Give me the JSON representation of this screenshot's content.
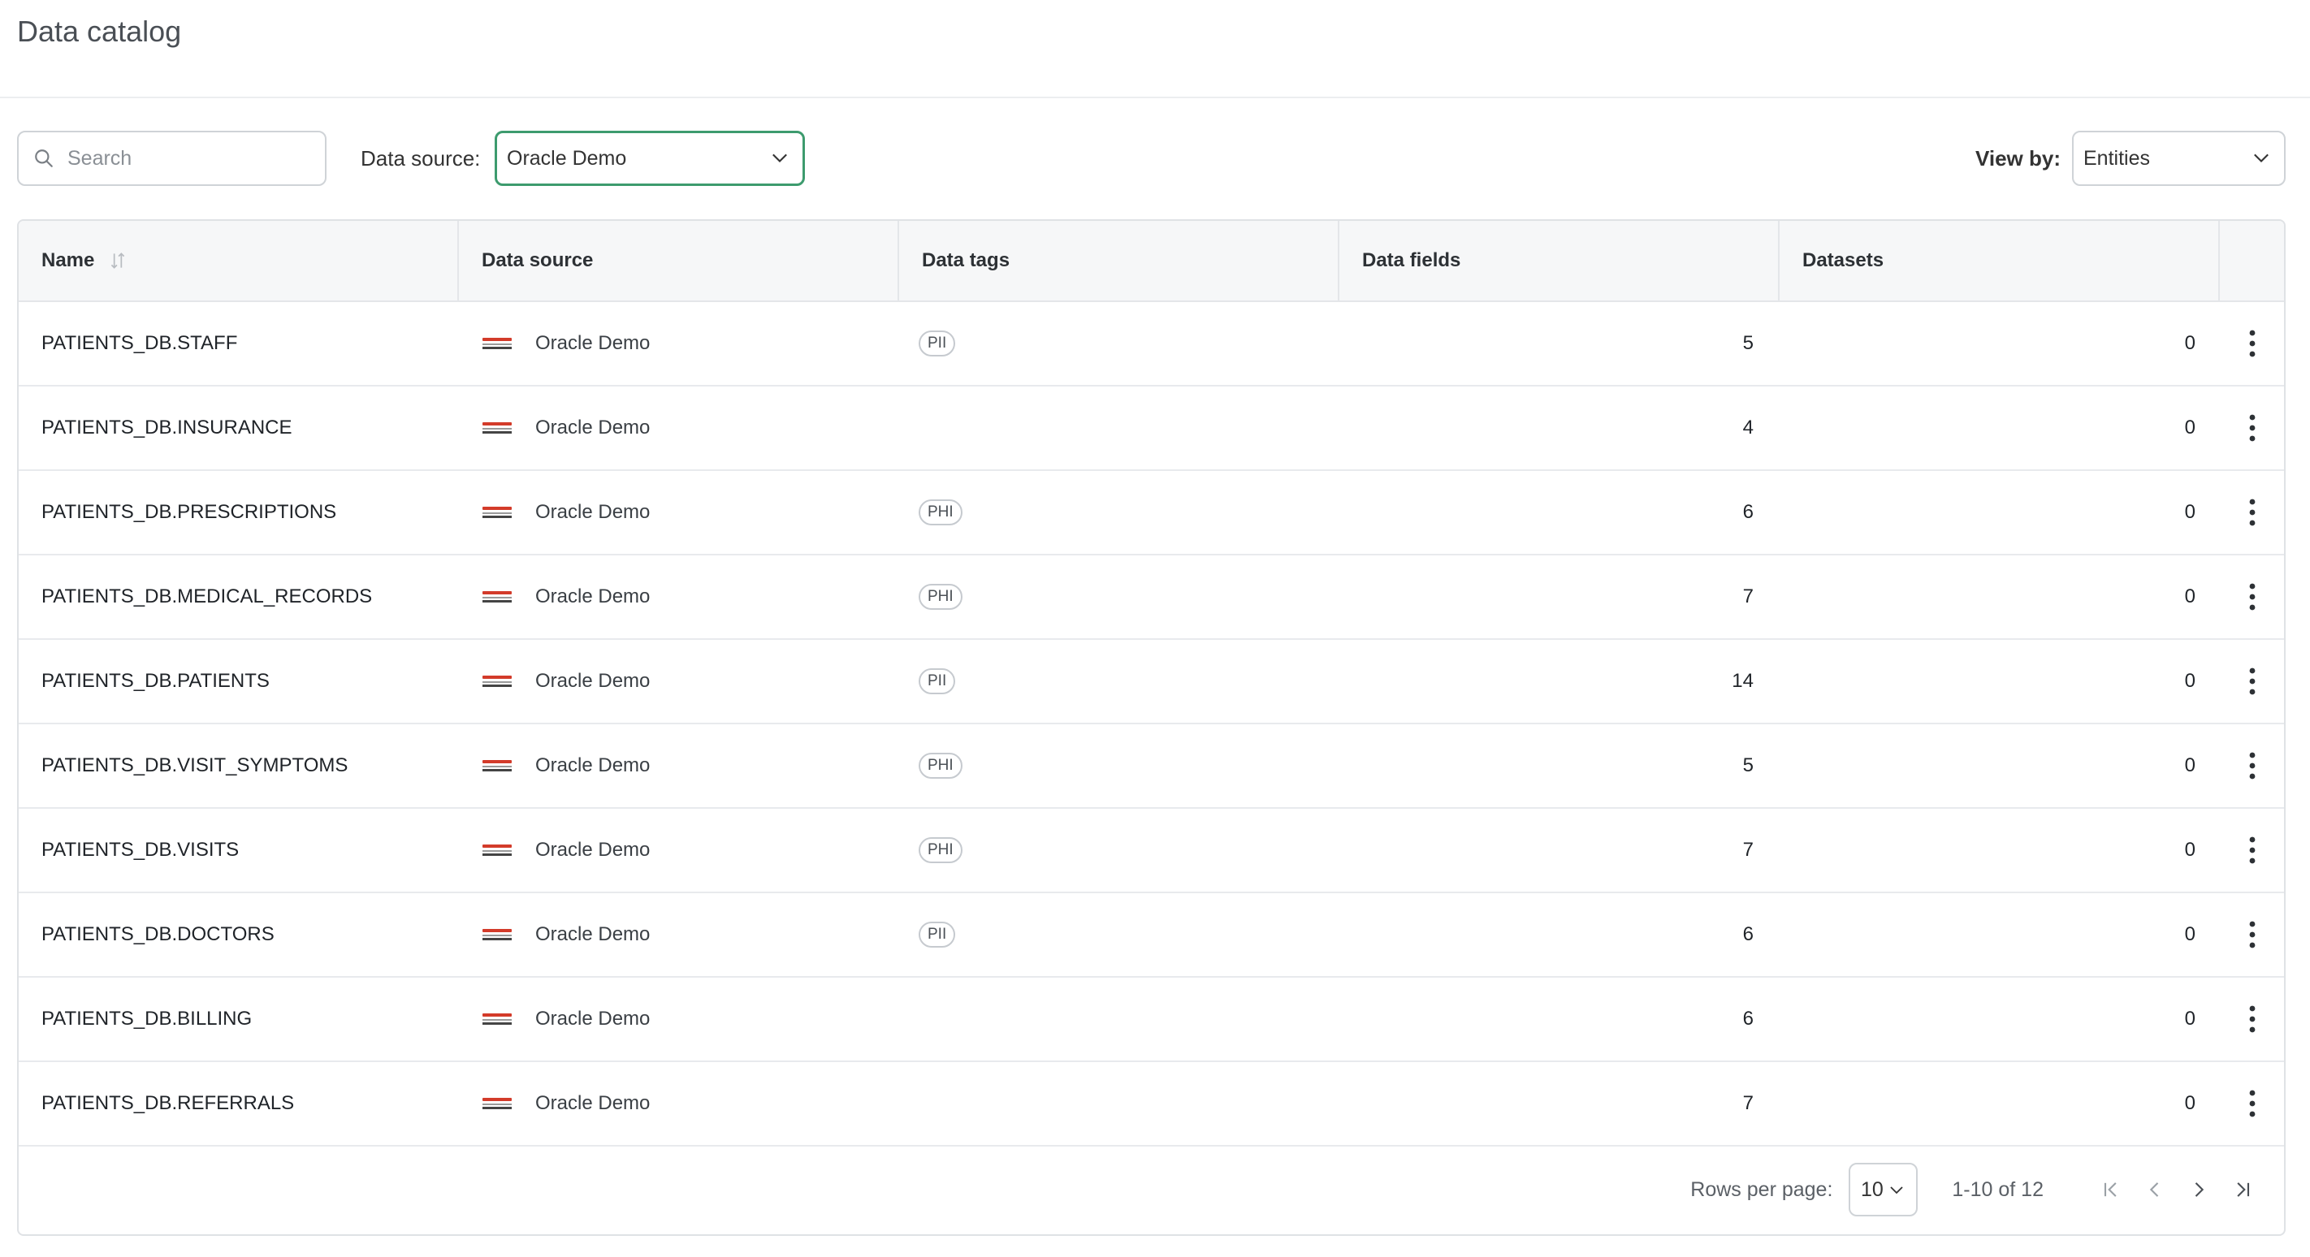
{
  "page": {
    "title": "Data catalog"
  },
  "toolbar": {
    "search_placeholder": "Search",
    "data_source_label": "Data source:",
    "data_source_value": "Oracle Demo",
    "view_by_label": "View by:",
    "view_by_value": "Entities"
  },
  "table": {
    "columns": [
      "Name",
      "Data source",
      "Data tags",
      "Data fields",
      "Datasets"
    ],
    "rows": [
      {
        "name": "PATIENTS_DB.STAFF",
        "source": "Oracle Demo",
        "tag": "PII",
        "fields": "5",
        "datasets": "0"
      },
      {
        "name": "PATIENTS_DB.INSURANCE",
        "source": "Oracle Demo",
        "tag": "",
        "fields": "4",
        "datasets": "0"
      },
      {
        "name": "PATIENTS_DB.PRESCRIPTIONS",
        "source": "Oracle Demo",
        "tag": "PHI",
        "fields": "6",
        "datasets": "0"
      },
      {
        "name": "PATIENTS_DB.MEDICAL_RECORDS",
        "source": "Oracle Demo",
        "tag": "PHI",
        "fields": "7",
        "datasets": "0"
      },
      {
        "name": "PATIENTS_DB.PATIENTS",
        "source": "Oracle Demo",
        "tag": "PII",
        "fields": "14",
        "datasets": "0"
      },
      {
        "name": "PATIENTS_DB.VISIT_SYMPTOMS",
        "source": "Oracle Demo",
        "tag": "PHI",
        "fields": "5",
        "datasets": "0"
      },
      {
        "name": "PATIENTS_DB.VISITS",
        "source": "Oracle Demo",
        "tag": "PHI",
        "fields": "7",
        "datasets": "0"
      },
      {
        "name": "PATIENTS_DB.DOCTORS",
        "source": "Oracle Demo",
        "tag": "PII",
        "fields": "6",
        "datasets": "0"
      },
      {
        "name": "PATIENTS_DB.BILLING",
        "source": "Oracle Demo",
        "tag": "",
        "fields": "6",
        "datasets": "0"
      },
      {
        "name": "PATIENTS_DB.REFERRALS",
        "source": "Oracle Demo",
        "tag": "",
        "fields": "7",
        "datasets": "0"
      }
    ]
  },
  "pagination": {
    "rows_per_page_label": "Rows per page:",
    "rows_per_page_value": "10",
    "range_text": "1-10 of 12"
  },
  "colors": {
    "accent_border": "#3d9b6e",
    "oracle_red": "#d33b2a"
  }
}
